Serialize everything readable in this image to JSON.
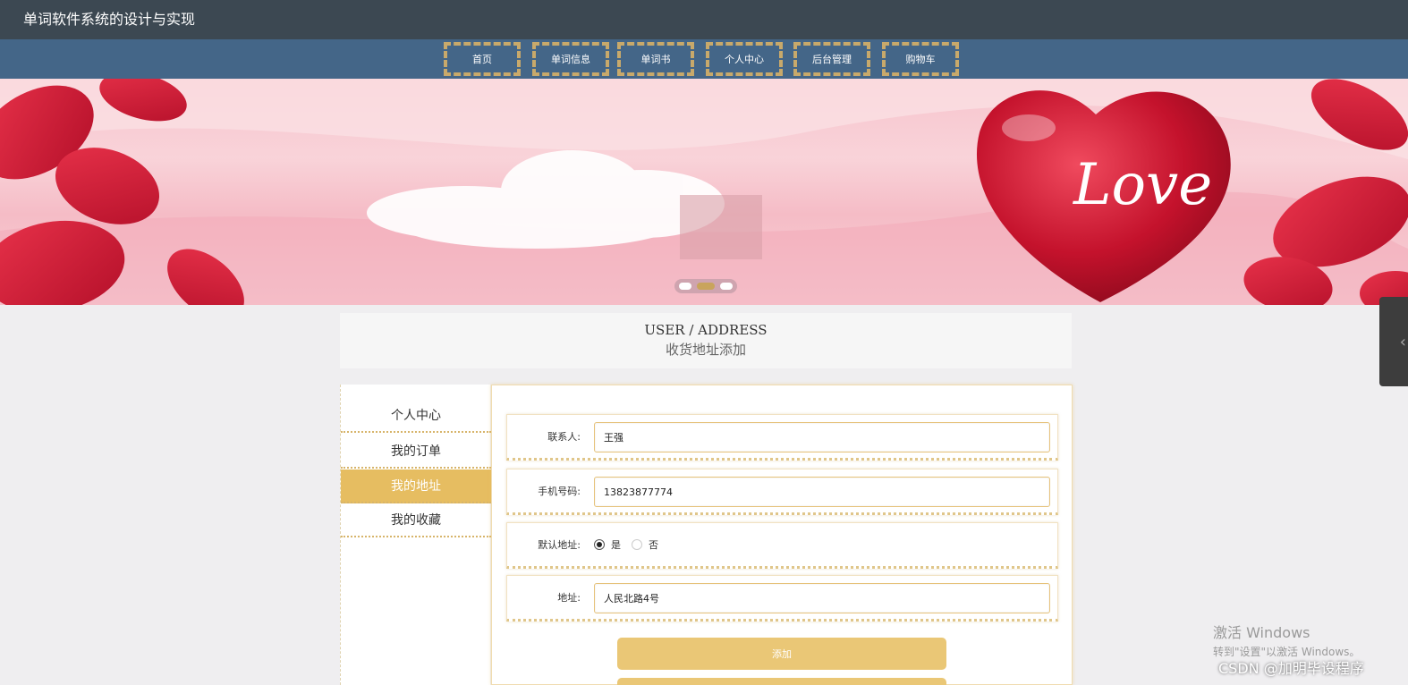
{
  "site": {
    "title": "单词软件系统的设计与实现"
  },
  "nav": {
    "items": [
      "首页",
      "单词信息",
      "单词书",
      "个人中心",
      "后台管理",
      "购物车"
    ]
  },
  "banner": {
    "text": "Love"
  },
  "header": {
    "en": "USER / ADDRESS",
    "cn": "收货地址添加"
  },
  "menu": {
    "items": [
      "个人中心",
      "我的订单",
      "我的地址",
      "我的收藏"
    ],
    "active_index": 2
  },
  "form": {
    "contact_label": "联系人:",
    "contact_value": "王强",
    "phone_label": "手机号码:",
    "phone_value": "13823877774",
    "default_label": "默认地址:",
    "default_yes": "是",
    "default_no": "否",
    "default_selected": "是",
    "address_label": "地址:",
    "address_value": "人民北路4号",
    "submit_label": "添加"
  },
  "watermark": {
    "line1": "激活 Windows",
    "line2": "转到\"设置\"以激活 Windows。",
    "csdn": "CSDN @加明毕设程序"
  },
  "colors": {
    "accent": "#e6bd61",
    "topbar": "#3c4852",
    "navbar": "#446688",
    "nav_border": "#c8a96b"
  }
}
